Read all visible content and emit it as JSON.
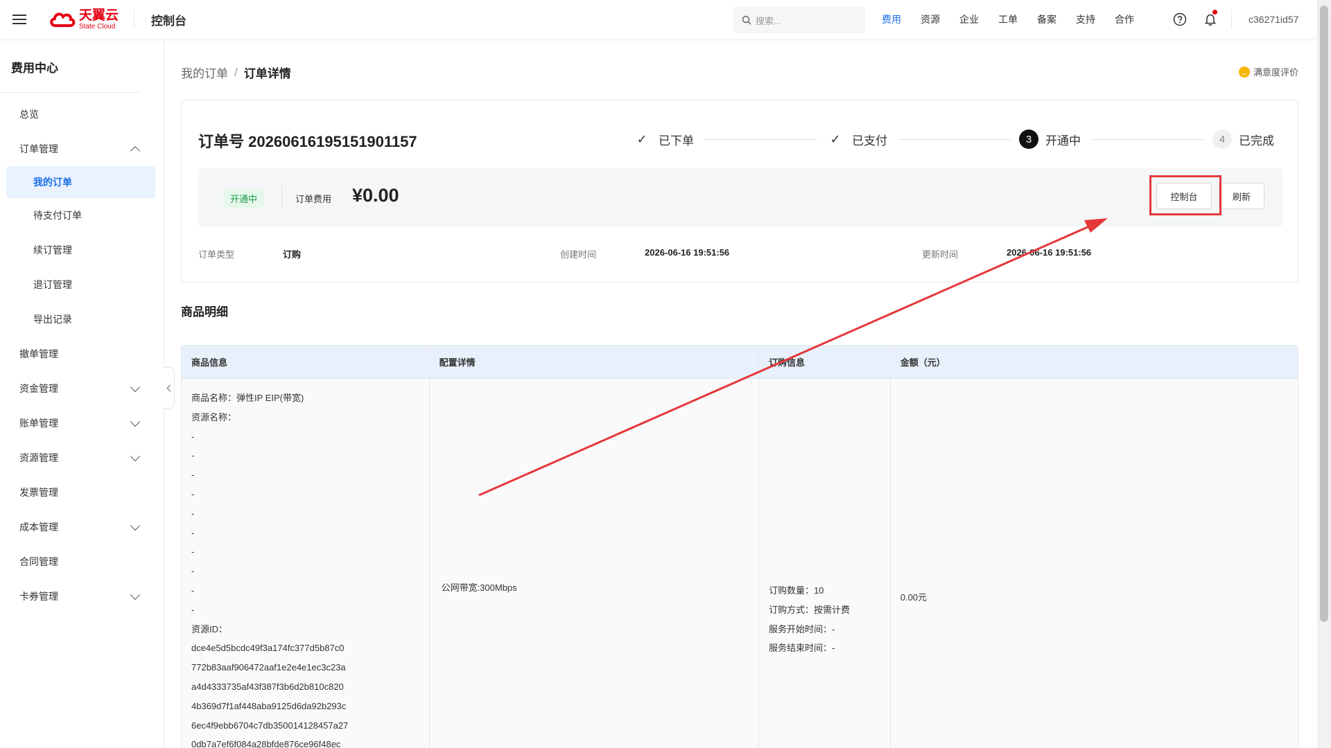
{
  "header": {
    "logo_cn": "天翼云",
    "logo_en": "State Cloud",
    "console": "控制台",
    "search_placeholder": "搜索...",
    "nav": [
      "费用",
      "资源",
      "企业",
      "工单",
      "备案",
      "支持",
      "合作"
    ],
    "active_nav": "费用",
    "user_id": "c36271id57"
  },
  "sidebar": {
    "title": "费用中心",
    "items": [
      {
        "label": "总览"
      },
      {
        "label": "订单管理"
      },
      {
        "label": "我的订单"
      },
      {
        "label": "待支付订单"
      },
      {
        "label": "续订管理"
      },
      {
        "label": "退订管理"
      },
      {
        "label": "导出记录"
      },
      {
        "label": "撤单管理"
      },
      {
        "label": "资金管理"
      },
      {
        "label": "账单管理"
      },
      {
        "label": "资源管理"
      },
      {
        "label": "发票管理"
      },
      {
        "label": "成本管理"
      },
      {
        "label": "合同管理"
      },
      {
        "label": "卡券管理"
      }
    ]
  },
  "breadcrumb": {
    "parent": "我的订单",
    "sep": "/",
    "current": "订单详情"
  },
  "satisfaction": "满意度评价",
  "order": {
    "number_label": "订单号",
    "number": "20260616195151901157",
    "steps": [
      {
        "label": "已下单",
        "mark": "✓"
      },
      {
        "label": "已支付",
        "mark": "✓"
      },
      {
        "label": "开通中",
        "mark": "3"
      },
      {
        "label": "已完成",
        "mark": "4"
      }
    ],
    "status_tag": "开通中",
    "fee_label": "订单费用",
    "fee_value": "¥0.00",
    "btn_console": "控制台",
    "btn_refresh": "刷新",
    "meta": {
      "type_label": "订单类型",
      "type_value": "订购",
      "created_label": "创建时间",
      "created_value": "2026-06-16 19:51:56",
      "updated_label": "更新时间",
      "updated_value": "2026-06-16 19:51:56"
    }
  },
  "goods": {
    "title": "商品明细",
    "headers": [
      "商品信息",
      "配置详情",
      "订购信息",
      "金额（元）"
    ],
    "info_lines": [
      "商品名称：弹性IP EIP(带宽)",
      "资源名称：",
      "-",
      "-",
      "-",
      "-",
      "-",
      "-",
      "-",
      "-",
      "-",
      "-",
      "资源ID：",
      "dce4e5d5bcdc49f3a174fc377d5b87c0",
      "772b83aaf906472aaf1e2e4e1ec3c23a",
      "a4d4333735af43f387f3b6d2b810c820",
      "4b369d7f1af448aba9125d6da92b293c",
      "6ec4f9ebb6704c7db350014128457a27",
      "0db7a7ef6f084a28bfde876ce96f48ec"
    ],
    "config": "公网带宽:300Mbps",
    "purchase_lines": [
      "订购数量：10",
      "订购方式：按需计费",
      "服务开始时间：-",
      "服务结束时间：-"
    ],
    "amount": "0.00元"
  },
  "colors": {
    "brand": "#e60012",
    "accent": "#1a6fe8",
    "annotation": "#e5383b"
  }
}
